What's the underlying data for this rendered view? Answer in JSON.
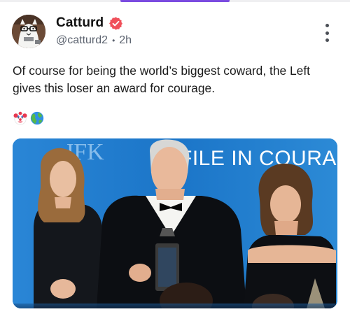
{
  "post": {
    "author_name": "Catturd",
    "author_handle": "@catturd2",
    "separator": "•",
    "timestamp": "2h",
    "text": "Of course for being the world’s biggest coward, the Left gives this loser an award for courage.",
    "emojis": [
      "clown-face",
      "globe-europe-africa"
    ],
    "media_caption_visible": "FILE IN COURA",
    "media_caption_left": "JFK"
  },
  "colors": {
    "accent": "#7b4be0",
    "verified_badge": "#f0505a",
    "meta_text": "#5d6470"
  },
  "icons": {
    "verified": "verified-badge-icon",
    "more": "more-options-icon"
  }
}
